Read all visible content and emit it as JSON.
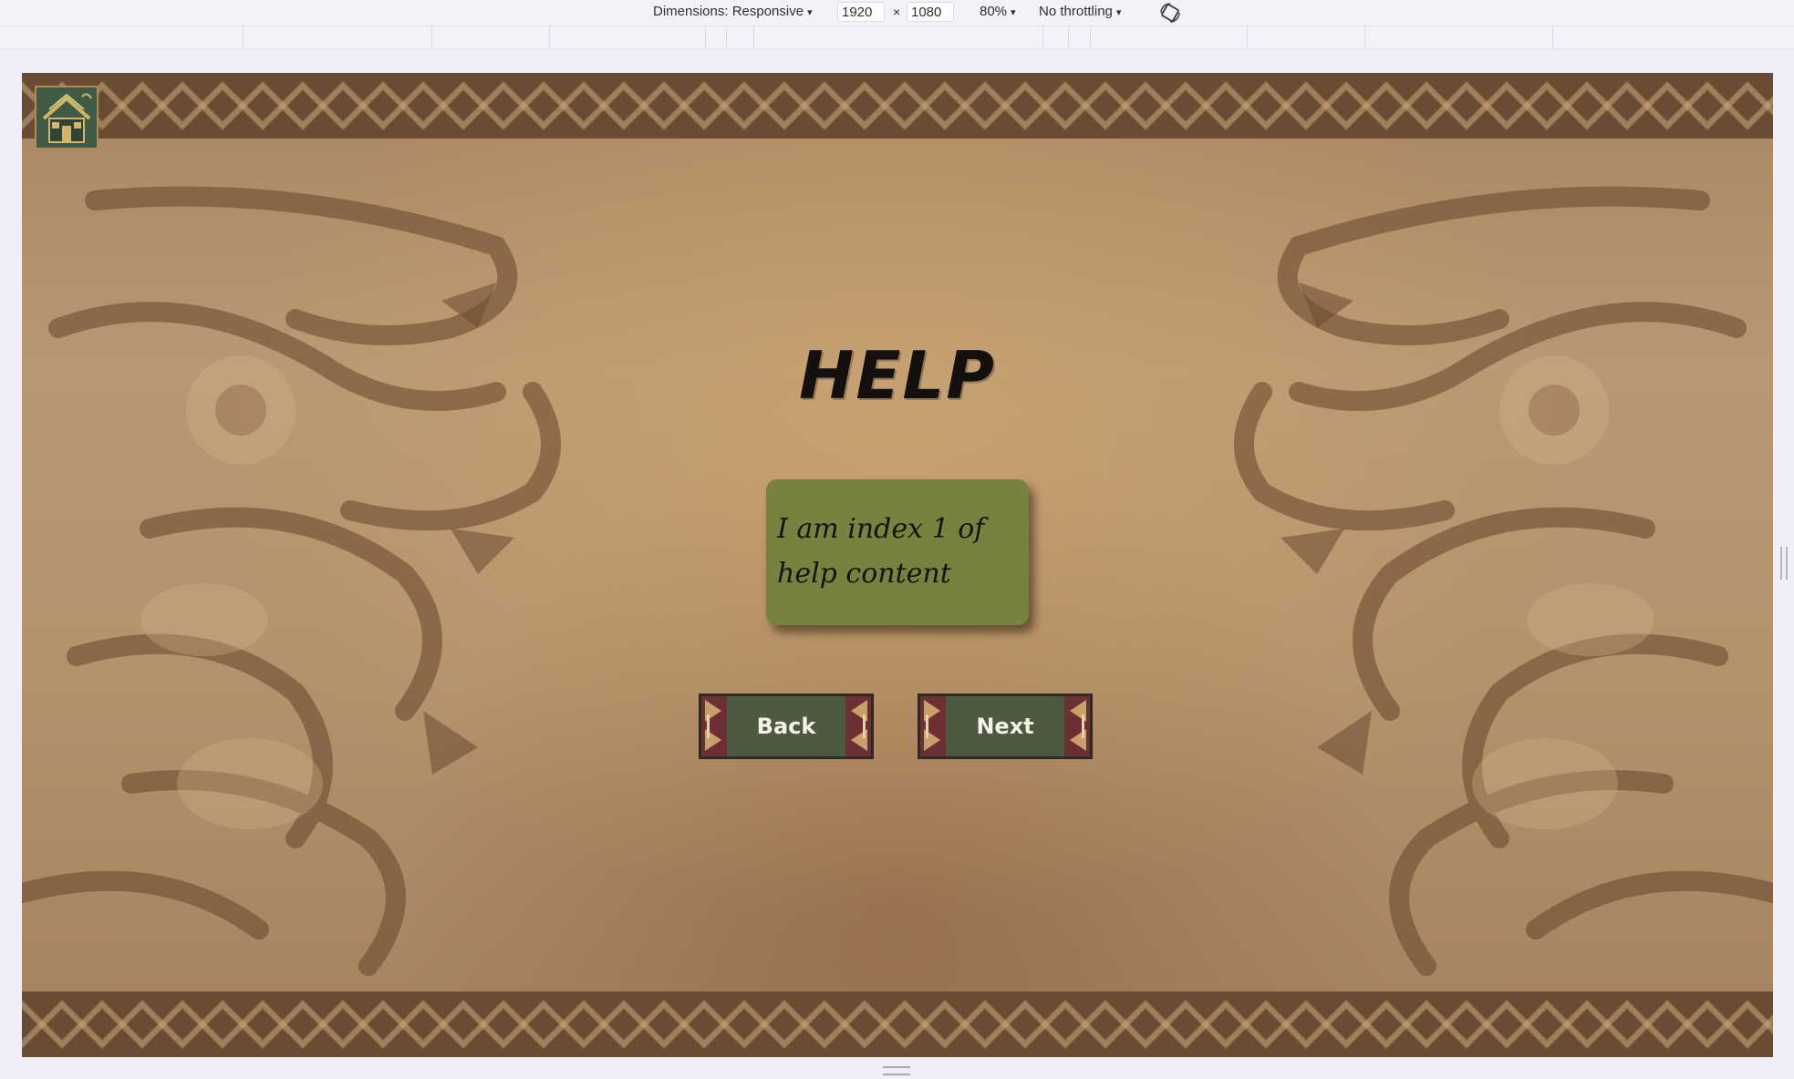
{
  "devtools": {
    "dimensions_label": "Dimensions: Responsive",
    "width_value": "1920",
    "times": "×",
    "height_value": "1080",
    "zoom": "80%",
    "throttling": "No throttling",
    "caret": "▾"
  },
  "game": {
    "title": "HELP",
    "help_text": "I am index 1 of help content",
    "back_label": "Back",
    "next_label": "Next"
  },
  "colors": {
    "button_green": "#4d5a3f",
    "card_green": "#76833f",
    "parchment": "#b3926c",
    "band_brown": "#6a4b34"
  }
}
